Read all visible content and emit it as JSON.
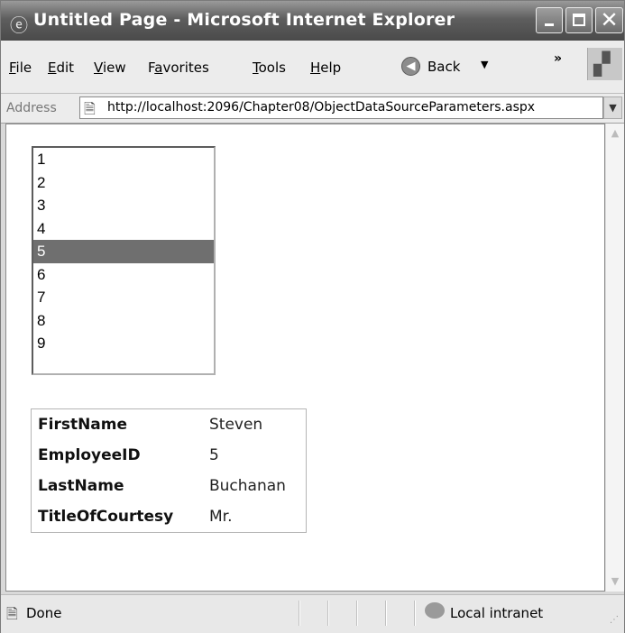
{
  "window": {
    "title": "Untitled Page - Microsoft Internet Explorer",
    "close_glyph": "✕"
  },
  "menu": {
    "items": [
      {
        "label": "File",
        "underline": "F",
        "rest": "ile"
      },
      {
        "label": "Edit",
        "underline": "E",
        "rest": "dit"
      },
      {
        "label": "View",
        "underline": "V",
        "rest": "iew"
      },
      {
        "label": "Favorites",
        "pre": "F",
        "underline": "a",
        "rest": "vorites"
      },
      {
        "label": "Tools",
        "underline": "T",
        "rest": "ools"
      },
      {
        "label": "Help",
        "underline": "H",
        "rest": "elp"
      }
    ],
    "back_label": "Back",
    "overflow_glyph": "»"
  },
  "address": {
    "label": "Address",
    "url": "http://localhost:2096/Chapter08/ObjectDataSourceParameters.aspx"
  },
  "listbox": {
    "items": [
      "1",
      "2",
      "3",
      "4",
      "5",
      "6",
      "7",
      "8",
      "9"
    ],
    "selected": "5"
  },
  "details": {
    "rows": [
      {
        "key": "FirstName",
        "value": "Steven"
      },
      {
        "key": "EmployeeID",
        "value": "5"
      },
      {
        "key": "LastName",
        "value": "Buchanan"
      },
      {
        "key": "TitleOfCourtesy",
        "value": "Mr."
      }
    ]
  },
  "status": {
    "text": "Done",
    "zone": "Local intranet"
  },
  "icons": {
    "title": "ie-icon",
    "back": "back-arrow-icon",
    "page": "page-icon",
    "zone": "intranet-icon"
  }
}
